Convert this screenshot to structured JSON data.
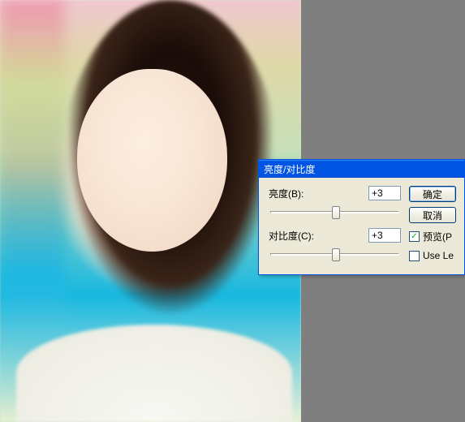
{
  "canvas": {
    "description": "photo-of-person-in-store"
  },
  "dialog": {
    "title": "亮度/对比度",
    "brightness": {
      "label": "亮度(B):",
      "value": "+3"
    },
    "contrast": {
      "label": "对比度(C):",
      "value": "+3"
    },
    "buttons": {
      "ok": "确定",
      "cancel": "取消"
    },
    "preview": {
      "label": "预览(P",
      "checked": true
    },
    "legacy": {
      "label": "Use Le",
      "checked": false
    }
  }
}
